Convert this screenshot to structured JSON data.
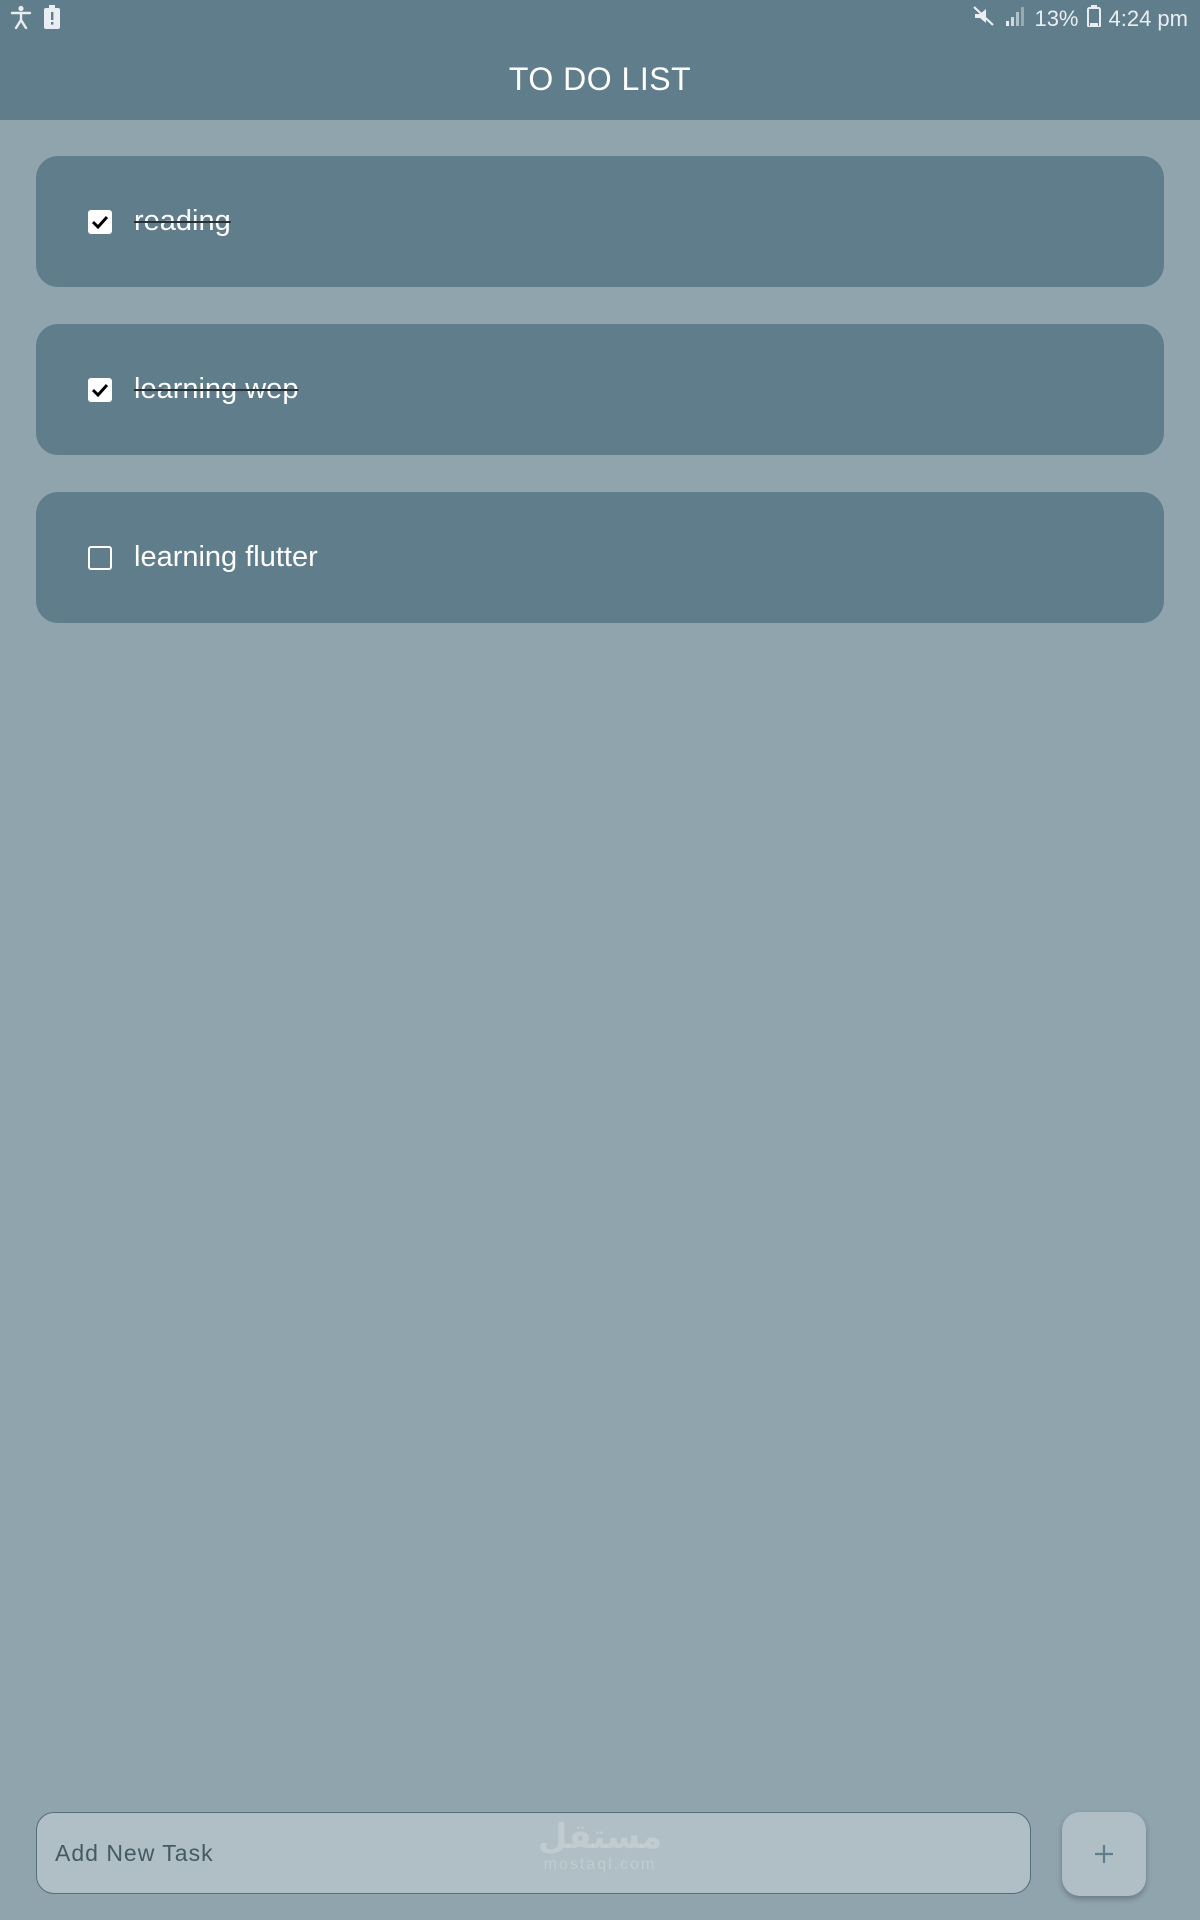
{
  "status_bar": {
    "battery_percent": "13%",
    "time": "4:24 pm",
    "left_icons": [
      "accessibility-icon",
      "battery-alert-icon"
    ],
    "right_icons": [
      "mute-icon",
      "signal-icon",
      "battery-icon"
    ]
  },
  "app_bar": {
    "title": "TO DO LIST"
  },
  "tasks": [
    {
      "label": "reading",
      "checked": true
    },
    {
      "label": "learning wep",
      "checked": true
    },
    {
      "label": "learning flutter",
      "checked": false
    }
  ],
  "input": {
    "placeholder": "Add New Task",
    "value": ""
  },
  "add_button": {
    "icon": "plus-icon"
  },
  "watermark": {
    "line1": "مستقل",
    "line2": "mostaql.com"
  },
  "colors": {
    "appbar": "#607d8b",
    "background": "#90a4ae",
    "card": "#607d8b",
    "input": "#b0bec5"
  }
}
